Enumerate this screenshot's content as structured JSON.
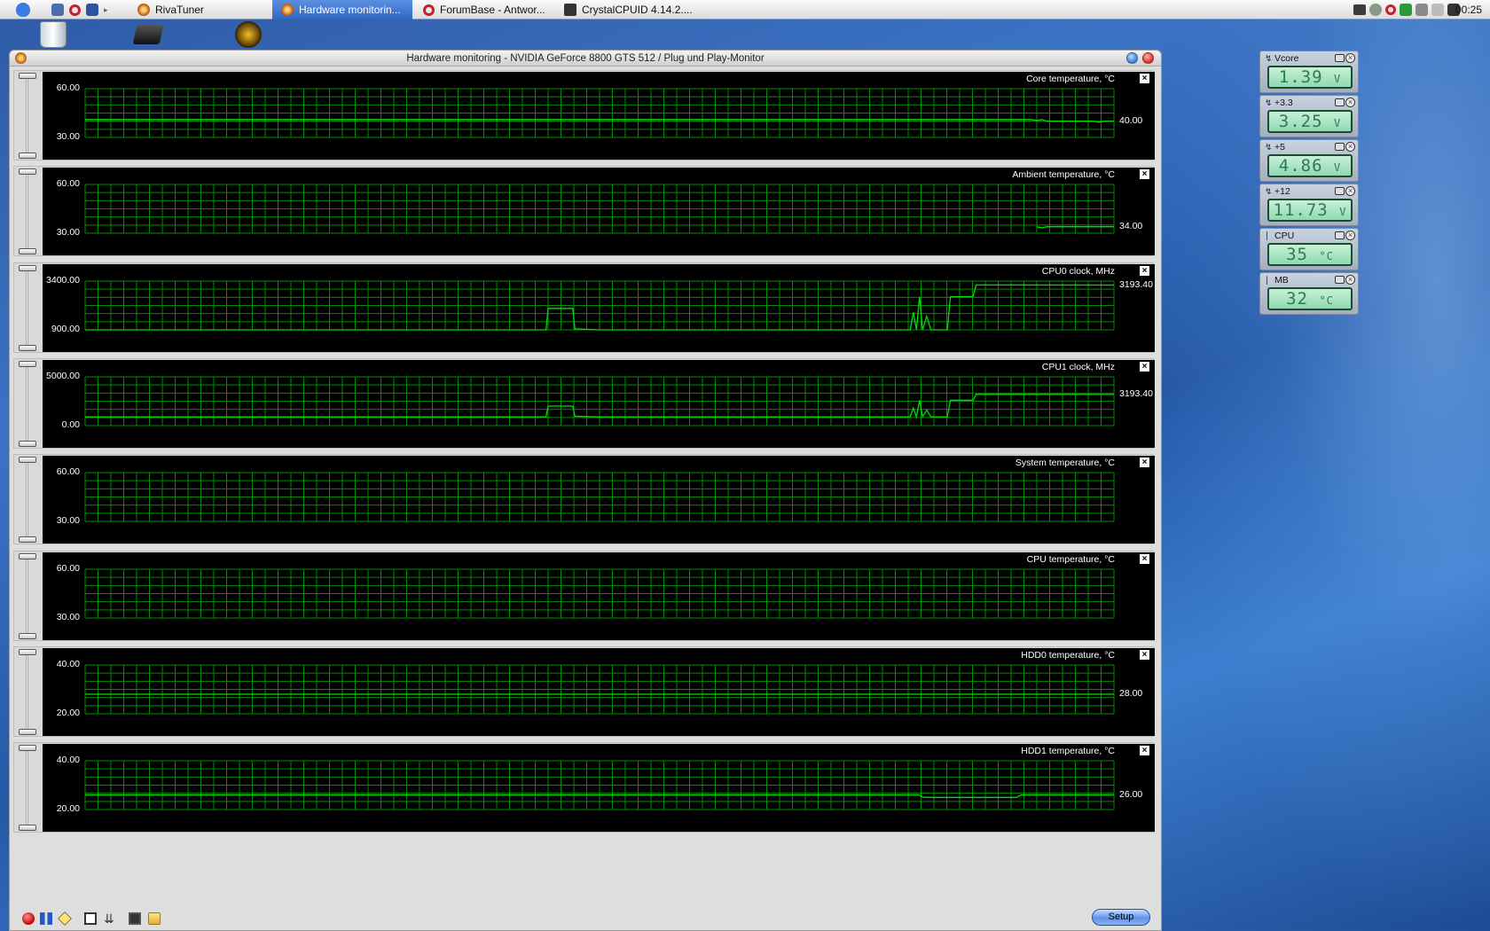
{
  "menubar": {
    "apps": [
      {
        "label": "RivaTuner"
      },
      {
        "label": "Hardware monitorin..."
      },
      {
        "label": "ForumBase - Antwor..."
      },
      {
        "label": "CrystalCPUID 4.14.2...."
      }
    ],
    "clock": "00:25"
  },
  "window": {
    "title": "Hardware monitoring - NVIDIA GeForce 8800 GTS 512 / Plug und Play-Monitor",
    "setup_label": "Setup"
  },
  "graphs": [
    {
      "title": "Core temperature, °C",
      "max_label": "60.00",
      "min_label": "30.00",
      "ymin": 30,
      "ymax": 60,
      "current": "40.00",
      "points": [
        [
          0,
          41
        ],
        [
          0.92,
          41
        ],
        [
          0.925,
          40.4
        ],
        [
          0.93,
          41
        ],
        [
          0.935,
          40
        ],
        [
          0.98,
          40
        ],
        [
          0.985,
          39.3
        ],
        [
          0.99,
          40
        ],
        [
          1,
          40
        ]
      ]
    },
    {
      "title": "Ambient temperature, °C",
      "max_label": "60.00",
      "min_label": "30.00",
      "ymin": 30,
      "ymax": 60,
      "current": "34.00",
      "points": [
        [
          0.925,
          34
        ],
        [
          0.93,
          33.3
        ],
        [
          0.935,
          34
        ],
        [
          1,
          34
        ]
      ]
    },
    {
      "title": "CPU0 clock, MHz",
      "max_label": "3400.00",
      "min_label": "900.00",
      "ymin": 900,
      "ymax": 3400,
      "current": "3193.40",
      "points": [
        [
          0,
          900
        ],
        [
          0.448,
          900
        ],
        [
          0.45,
          2000
        ],
        [
          0.474,
          2000
        ],
        [
          0.476,
          950
        ],
        [
          0.5,
          900
        ],
        [
          0.802,
          900
        ],
        [
          0.805,
          1800
        ],
        [
          0.808,
          900
        ],
        [
          0.811,
          2600
        ],
        [
          0.814,
          900
        ],
        [
          0.818,
          1600
        ],
        [
          0.822,
          900
        ],
        [
          0.838,
          900
        ],
        [
          0.841,
          2600
        ],
        [
          0.863,
          2600
        ],
        [
          0.866,
          3200
        ],
        [
          0.9,
          3200
        ],
        [
          1,
          3193.4
        ]
      ]
    },
    {
      "title": "CPU1 clock, MHz",
      "max_label": "5000.00",
      "min_label": "0.00",
      "ymin": 0,
      "ymax": 5000,
      "current": "3193.40",
      "points": [
        [
          0,
          900
        ],
        [
          0.448,
          900
        ],
        [
          0.45,
          2000
        ],
        [
          0.474,
          2000
        ],
        [
          0.476,
          950
        ],
        [
          0.5,
          900
        ],
        [
          0.802,
          900
        ],
        [
          0.805,
          1800
        ],
        [
          0.808,
          900
        ],
        [
          0.811,
          2600
        ],
        [
          0.814,
          900
        ],
        [
          0.818,
          1600
        ],
        [
          0.822,
          900
        ],
        [
          0.838,
          900
        ],
        [
          0.841,
          2600
        ],
        [
          0.863,
          2600
        ],
        [
          0.866,
          3200
        ],
        [
          0.9,
          3200
        ],
        [
          1,
          3193.4
        ]
      ]
    },
    {
      "title": "System temperature, °C",
      "max_label": "60.00",
      "min_label": "30.00",
      "ymin": 30,
      "ymax": 60,
      "current": "",
      "points": []
    },
    {
      "title": "CPU temperature, °C",
      "max_label": "60.00",
      "min_label": "30.00",
      "ymin": 30,
      "ymax": 60,
      "current": "",
      "points": []
    },
    {
      "title": "HDD0 temperature, °C",
      "max_label": "40.00",
      "min_label": "20.00",
      "ymin": 20,
      "ymax": 40,
      "current": "28.00",
      "points": [
        [
          0,
          28
        ],
        [
          1,
          28
        ]
      ]
    },
    {
      "title": "HDD1 temperature, °C",
      "max_label": "40.00",
      "min_label": "20.00",
      "ymin": 20,
      "ymax": 40,
      "current": "26.00",
      "points": [
        [
          0,
          26
        ],
        [
          0.81,
          26
        ],
        [
          0.815,
          25
        ],
        [
          0.905,
          25
        ],
        [
          0.91,
          26
        ],
        [
          1,
          26
        ]
      ]
    }
  ],
  "widgets": [
    {
      "label": "Vcore",
      "value": "1.39",
      "unit": "V",
      "icon": "lightning-icon"
    },
    {
      "label": "+3.3",
      "value": "3.25",
      "unit": "V",
      "icon": "lightning-icon"
    },
    {
      "label": "+5",
      "value": "4.86",
      "unit": "V",
      "icon": "lightning-icon"
    },
    {
      "label": "+12",
      "value": "11.73",
      "unit": "V",
      "icon": "lightning-icon"
    },
    {
      "label": "CPU",
      "value": "35",
      "unit": "°C",
      "icon": "thermometer-icon"
    },
    {
      "label": "MB",
      "value": "32",
      "unit": "°C",
      "icon": "thermometer-icon"
    }
  ],
  "colors": {
    "graph_grid": "#008f00",
    "graph_line": "#00e000",
    "graph_bg": "#000000",
    "lcd_text": "#2f7a54"
  }
}
